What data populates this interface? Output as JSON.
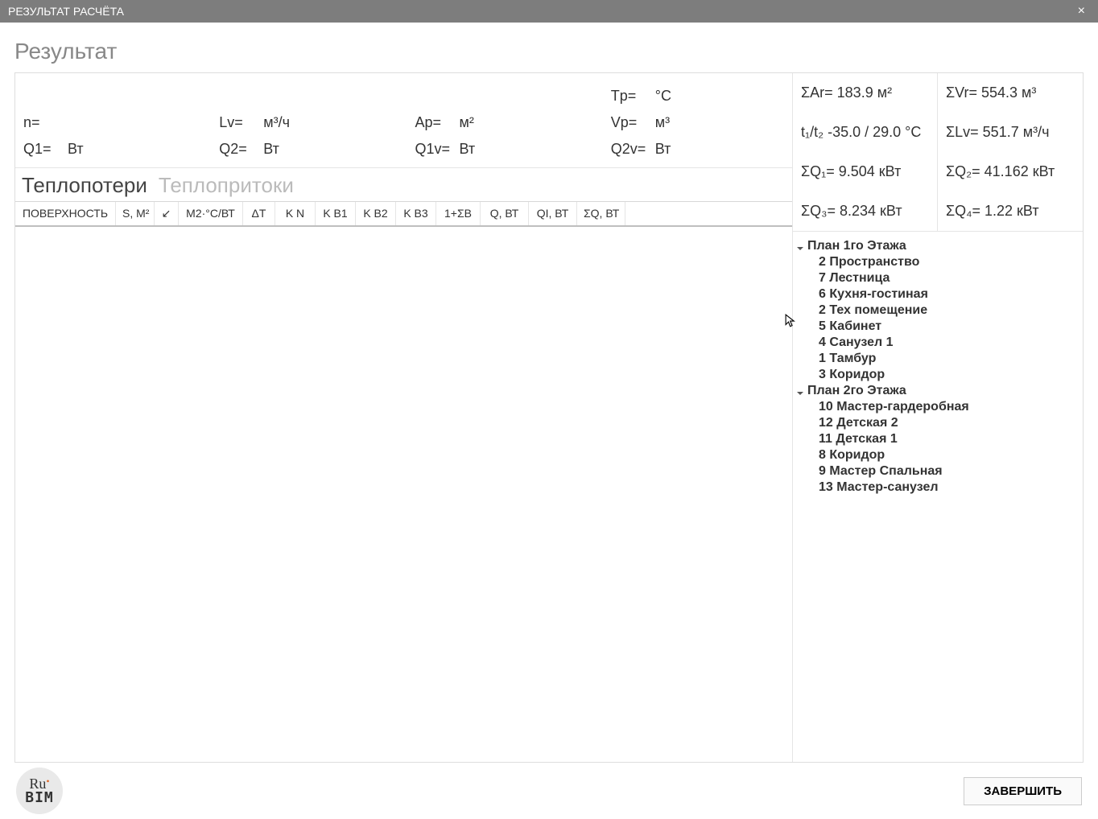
{
  "window": {
    "title": "РЕЗУЛЬТАТ РАСЧЁТА"
  },
  "page": {
    "heading": "Результат"
  },
  "params": {
    "n": {
      "label": "n=",
      "value": "",
      "unit": ""
    },
    "Lv": {
      "label": "Lv=",
      "value": "",
      "unit": "м³/ч"
    },
    "Ap": {
      "label": "Ap=",
      "value": "",
      "unit": "м²"
    },
    "Tp": {
      "label": "Tp=",
      "value": "",
      "unit": "°C"
    },
    "Vp": {
      "label": "Vp=",
      "value": "",
      "unit": "м³"
    },
    "Q1": {
      "label": "Q1=",
      "value": "",
      "unit": "Вт"
    },
    "Q2": {
      "label": "Q2=",
      "value": "",
      "unit": "Вт"
    },
    "Q1v": {
      "label": "Q1v=",
      "value": "",
      "unit": "Вт"
    },
    "Q2v": {
      "label": "Q2v=",
      "value": "",
      "unit": "Вт"
    }
  },
  "tabs": {
    "losses": "Теплопотери",
    "gains": "Теплопритоки",
    "active": "losses"
  },
  "table": {
    "headers": [
      "ПОВЕРХНОСТЬ",
      "S, М²",
      "↙",
      "М2·°C/ВТ",
      "ΔT",
      "K N",
      "K B1",
      "K B2",
      "K B3",
      "1+ΣB",
      "Q, ВТ",
      "QI, ВТ",
      "ΣQ, ВТ"
    ],
    "widths": [
      125,
      48,
      30,
      80,
      40,
      50,
      50,
      50,
      50,
      55,
      60,
      60,
      60
    ]
  },
  "summary": {
    "SA": {
      "label": "ΣAr=",
      "value": "183.9 м²"
    },
    "SV": {
      "label": "ΣVr=",
      "value": "554.3 м³"
    },
    "t12": {
      "label": "t₁/t₂",
      "value": "-35.0 / 29.0 °C"
    },
    "SL": {
      "label": "ΣLv=",
      "value": "551.7 м³/ч"
    },
    "SQ1": {
      "label": "ΣQ₁=",
      "value": "9.504 кВт"
    },
    "SQ2": {
      "label": "ΣQ₂=",
      "value": "41.162 кВт"
    },
    "SQ3": {
      "label": "ΣQ₃=",
      "value": "8.234 кВт"
    },
    "SQ4": {
      "label": "ΣQ₄=",
      "value": "1.22 кВт"
    }
  },
  "tree": [
    {
      "label": "План 1го Этажа",
      "children": [
        "2 Пространство",
        "7 Лестница",
        "6 Кухня-гостиная",
        "2 Тех помещение",
        "5 Кабинет",
        "4 Санузел 1",
        "1 Тамбур",
        "3 Коридор"
      ]
    },
    {
      "label": "План 2го Этажа",
      "children": [
        "10 Мастер-гардеробная",
        "12 Детская 2",
        "11 Детская 1",
        "8 Коридор",
        "9 Мастер Спальная",
        "13 Мастер-санузел"
      ]
    }
  ],
  "footer": {
    "logo_ru": "Ru",
    "logo_bim": "BIM",
    "finish": "ЗАВЕРШИТЬ"
  }
}
